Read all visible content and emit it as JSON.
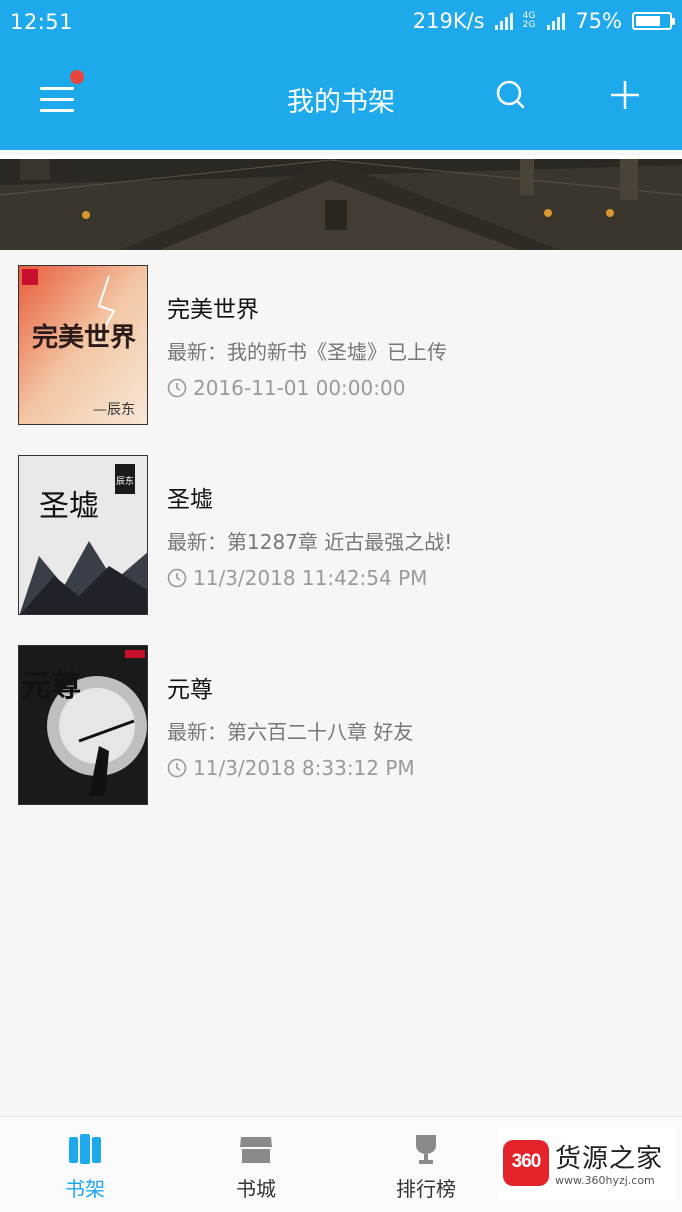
{
  "status_bar": {
    "time": "12:51",
    "speed": "219K/s",
    "network_top": "4G",
    "network_bottom": "2G",
    "battery": "75%",
    "battery_level": 0.75
  },
  "app_bar": {
    "title": "我的书架",
    "menu_icon": "menu-icon",
    "search_icon": "search-icon",
    "add_icon": "plus-icon",
    "accent": "#1ea9ec",
    "badge_color": "#e8453c"
  },
  "books": [
    {
      "title": "完美世界",
      "latest": "最新：我的新书《圣墟》已上传",
      "time": "2016-11-01 00:00:00",
      "cover_text": "完美世界",
      "cover_author": "—辰东"
    },
    {
      "title": "圣墟",
      "latest": "最新：第1287章 近古最强之战!",
      "time": "11/3/2018 11:42:54 PM",
      "cover_text": "圣墟",
      "cover_author": "辰东"
    },
    {
      "title": "元尊",
      "latest": "最新：第六百二十八章 好友",
      "time": "11/3/2018 8:33:12 PM",
      "cover_text": "元尊",
      "cover_author": ""
    }
  ],
  "tabs": [
    {
      "label": "书架",
      "icon": "bookshelf-icon",
      "active": true
    },
    {
      "label": "书城",
      "icon": "store-icon",
      "active": false
    },
    {
      "label": "排行榜",
      "icon": "trophy-icon",
      "active": false
    }
  ],
  "watermark": {
    "logo": "360",
    "text": "货源之家",
    "url": "www.360hyzj.com"
  }
}
